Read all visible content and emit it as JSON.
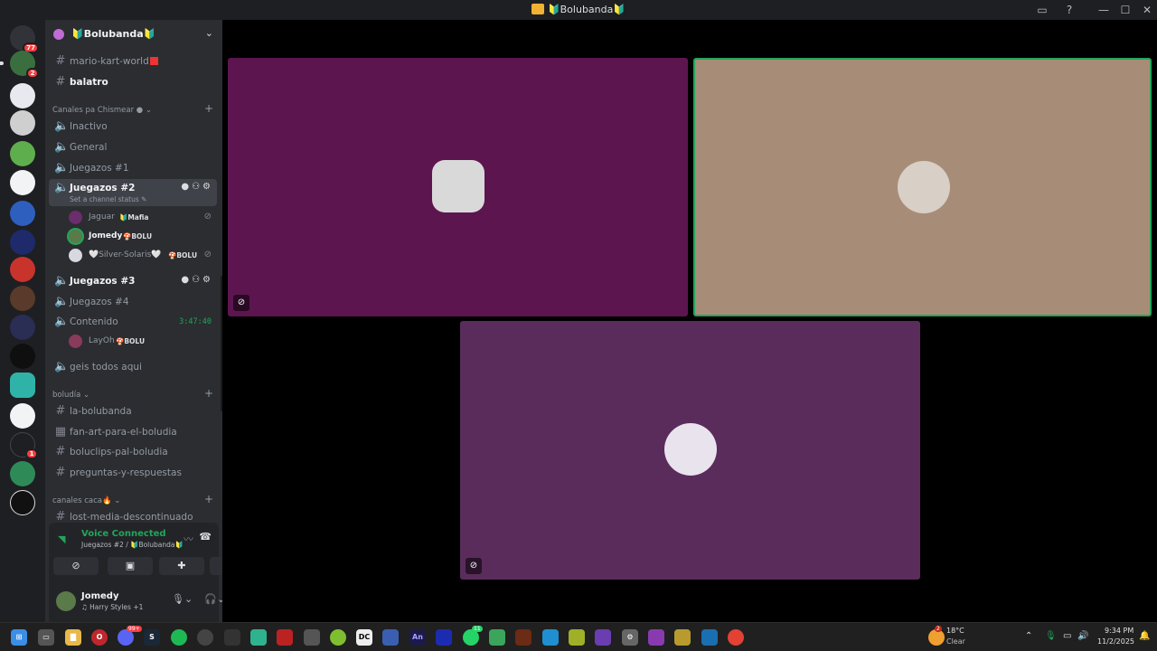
{
  "window": {
    "title": "🔰Bolubanda🔰"
  },
  "rail": {
    "badges": [
      "77",
      "2",
      "1"
    ]
  },
  "guild": {
    "name": "🔰Bolubanda🔰"
  },
  "channels_top": [
    {
      "name": "mario-kart-world",
      "flag": true,
      "bright": false
    },
    {
      "name": "balatro",
      "flag": false,
      "bright": true
    }
  ],
  "categories": {
    "chismear": "Canales pa Chismear",
    "boludia": "boludía",
    "caca": "canales caca🔥"
  },
  "voice_channels": {
    "inactivo": "Inactivo",
    "general": "General",
    "juegazos1": "Juegazos #1",
    "juegazos2": "Juegazos #2",
    "juegazos2_status": "Set a channel status",
    "juegazos3": "Juegazos #3",
    "juegazos4": "Juegazos #4",
    "contenido": "Contenido",
    "contenido_timer": "3:47:40",
    "geis": "geis todos aqui"
  },
  "voice_users": [
    {
      "name": "Jaguar",
      "tag": "🔰Mafia",
      "speaking": false,
      "muted": true
    },
    {
      "name": "Jomedy",
      "tag": "🍄BOLU",
      "speaking": true,
      "muted": false
    },
    {
      "name": "🤍Silver-Solaris🤍",
      "tag": "🍄BOLU",
      "speaking": false,
      "muted": true
    },
    {
      "name": "LayOh",
      "tag": "🍄BOLU",
      "speaking": false,
      "muted": false
    }
  ],
  "text_channels_boludia": [
    "la-bolubanda",
    "fan-art-para-el-boludia",
    "boluclips-pal-boludia",
    "preguntas-y-respuestas"
  ],
  "text_channels_caca": [
    "lost-media-descontinuado"
  ],
  "voice_panel": {
    "status": "Voice Connected",
    "location": "Juegazos #2 / 🔰Bolubanda🔰"
  },
  "user_panel": {
    "name": "Jomedy",
    "activity": "♫ Harry Styles +1"
  },
  "colors": {
    "tile1": "#5d1550",
    "tile2": "#a78d78",
    "tile3": "#5a2c5c",
    "speaking": "#23a55a"
  },
  "taskbar": {
    "weather_temp": "18°C",
    "weather_state": "Clear",
    "time": "9:34 PM",
    "date": "11/2/2025",
    "app_badges": [
      "99+",
      "11"
    ],
    "weather_badge": "2"
  }
}
